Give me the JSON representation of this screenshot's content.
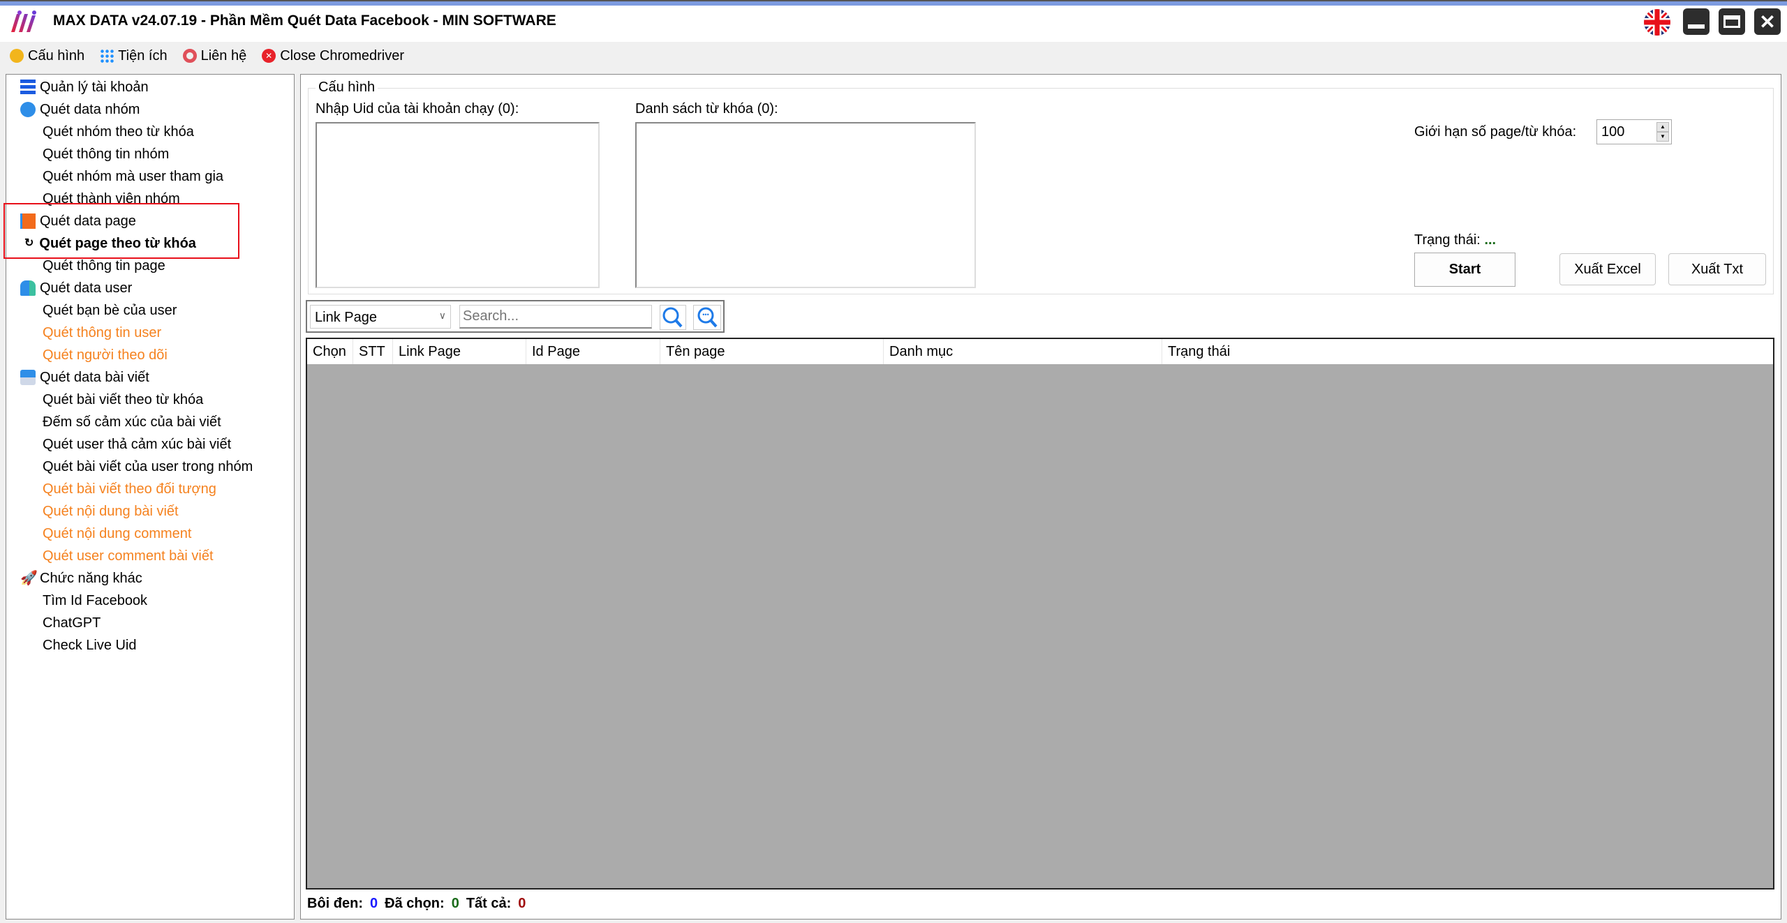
{
  "app": {
    "title": "MAX DATA v24.07.19 - Phần Mềm Quét Data Facebook - MIN SOFTWARE",
    "window_icons": [
      "language-uk-flag-icon",
      "minimize-icon",
      "maximize-icon",
      "close-icon"
    ]
  },
  "menu": [
    {
      "label": "Cấu hình",
      "icon": "wrench-icon"
    },
    {
      "label": "Tiện ích",
      "icon": "grid-dots-icon"
    },
    {
      "label": "Liên hệ",
      "icon": "lifebuoy-icon"
    },
    {
      "label": "Close Chromedriver",
      "icon": "red-x-circle-icon"
    }
  ],
  "sidebar": {
    "groups": [
      {
        "label": "Quản lý tài khoản",
        "icon": "list-icon",
        "items": []
      },
      {
        "label": "Quét data nhóm",
        "icon": "group-icon",
        "items": [
          {
            "label": "Quét nhóm theo từ khóa"
          },
          {
            "label": "Quét thông tin nhóm"
          },
          {
            "label": "Quét nhóm mà user tham gia"
          },
          {
            "label": "Quét thành viên nhóm"
          }
        ]
      },
      {
        "label": "Quét data page",
        "icon": "flag-icon",
        "items": [
          {
            "label": "Quét page theo từ khóa",
            "selected": true
          },
          {
            "label": "Quét thông tin page"
          }
        ]
      },
      {
        "label": "Quét data user",
        "icon": "users-icon",
        "items": [
          {
            "label": "Quét bạn bè của user"
          },
          {
            "label": "Quét thông tin user",
            "highlight": "orange"
          },
          {
            "label": "Quét người theo dõi",
            "highlight": "orange"
          }
        ]
      },
      {
        "label": "Quét data bài viết",
        "icon": "post-clock-icon",
        "items": [
          {
            "label": "Quét bài viết theo từ khóa"
          },
          {
            "label": "Đếm số cảm xúc của bài viết"
          },
          {
            "label": "Quét user thả cảm xúc bài viết"
          },
          {
            "label": "Quét bài viết của user trong nhóm"
          },
          {
            "label": "Quét bài viết theo đối tượng",
            "highlight": "orange"
          },
          {
            "label": "Quét nội dung bài viết",
            "highlight": "orange"
          },
          {
            "label": "Quét nội dung comment",
            "highlight": "orange"
          },
          {
            "label": "Quét user comment bài viết",
            "highlight": "orange"
          }
        ]
      },
      {
        "label": "Chức năng khác",
        "icon": "rocket-icon",
        "items": [
          {
            "label": "Tìm Id Facebook"
          },
          {
            "label": "ChatGPT"
          },
          {
            "label": "Check Live Uid"
          }
        ]
      }
    ]
  },
  "config": {
    "group_label": "Cấu hình",
    "uid_label": "Nhập Uid của tài khoản chạy (0):",
    "uid_value": "",
    "keywords_label": "Danh sách từ khóa (0):",
    "keywords_value": "",
    "limit_label": "Giới hạn số page/từ khóa:",
    "limit_value": "100",
    "status_label": "Trạng thái:",
    "status_value": "...",
    "start_label": "Start",
    "export_excel_label": "Xuất Excel",
    "export_txt_label": "Xuất Txt"
  },
  "search": {
    "field_selected": "Link Page",
    "placeholder": "Search...",
    "value": ""
  },
  "table": {
    "columns": [
      "Chọn",
      "STT",
      "Link Page",
      "Id Page",
      "Tên page",
      "Danh mục",
      "Trạng thái"
    ],
    "rows": []
  },
  "footer": {
    "highlighted_label": "Bôi đen:",
    "highlighted": "0",
    "selected_label": "Đã chọn:",
    "selected": "0",
    "total_label": "Tất cả:",
    "total": "0"
  },
  "colors": {
    "selection_box": "#e8101a",
    "orange_item": "#f5821f",
    "highlighted_count": "#1a1aff",
    "selected_count": "#1a6b1a",
    "total_count": "#a01010",
    "grid_bg": "#ababab"
  }
}
